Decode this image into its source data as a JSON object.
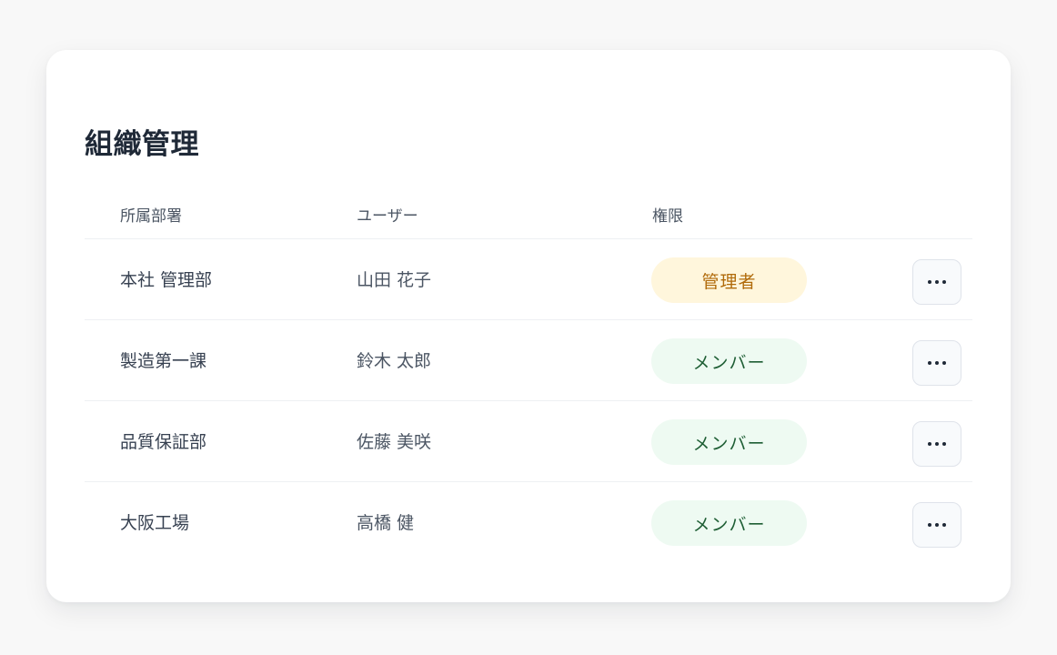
{
  "page": {
    "title": "組織管理"
  },
  "table": {
    "headers": {
      "department": "所属部署",
      "user": "ユーザー",
      "role": "権限"
    },
    "rows": [
      {
        "department": "本社 管理部",
        "user": "山田 花子",
        "role": "管理者",
        "role_type": "admin"
      },
      {
        "department": "製造第一課",
        "user": "鈴木 太郎",
        "role": "メンバー",
        "role_type": "member"
      },
      {
        "department": "品質保証部",
        "user": "佐藤 美咲",
        "role": "メンバー",
        "role_type": "member"
      },
      {
        "department": "大阪工場",
        "user": "高橋 健",
        "role": "メンバー",
        "role_type": "member"
      }
    ],
    "row_action_icon": "more-horizontal-icon"
  },
  "colors": {
    "admin_badge_bg": "#fff6dc",
    "admin_badge_text": "#b06a0a",
    "member_badge_bg": "#eefaf2",
    "member_badge_text": "#1e5e34"
  }
}
